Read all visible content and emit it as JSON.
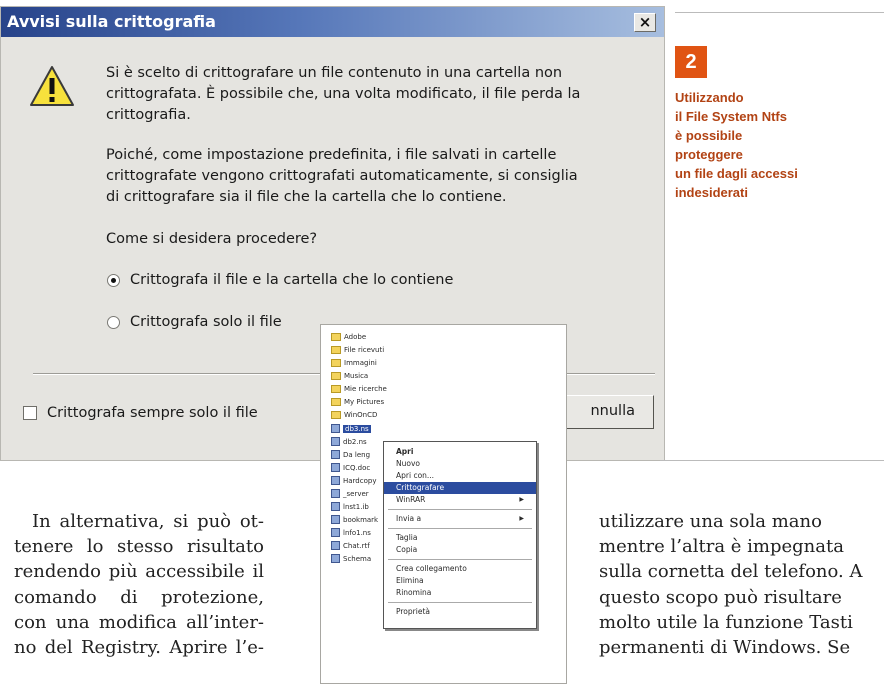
{
  "dialog": {
    "title": "Avvisi sulla crittografia",
    "close_glyph": "×",
    "icon": "warning-icon",
    "message1": [
      "Si è scelto di crittografare un file contenuto in una cartella non",
      "crittografata. È possibile che, una volta modificato, il file perda la",
      "crittografia."
    ],
    "message2": [
      "Poiché, come impostazione predefinita, i file salvati in cartelle",
      "crittografate vengono crittografati automaticamente, si consiglia",
      "di crittografare sia il file che la cartella che lo contiene."
    ],
    "question": "Come si desidera procedere?",
    "options": [
      {
        "label": "Crittografa il file e la cartella che lo contiene",
        "selected": true
      },
      {
        "label": "Crittografa solo il file",
        "selected": false
      }
    ],
    "checkbox_label": "Crittografa sempre solo il file",
    "cancel_visible_label": "nnulla"
  },
  "figure": {
    "number": "2",
    "caption": [
      "Utilizzando",
      "il File System Ntfs",
      "è possibile",
      "proteggere",
      "un file dagli accessi",
      "indesiderati"
    ],
    "accent_color": "#e05413"
  },
  "explorer": {
    "folders": [
      "Adobe",
      "File ricevuti",
      "Immagini",
      "Musica",
      "Mie ricerche",
      "My Pictures",
      "WinOnCD"
    ],
    "files": [
      "db3.ns",
      "db2.ns",
      "Da leng",
      "ICQ.doc",
      "Hardcopy",
      "_server",
      "lnst1.ib",
      "bookmark",
      "lnfo1.ns",
      "Chat.rtf",
      "Schema"
    ],
    "selected_file_index": 0,
    "context_menu": [
      {
        "label": "Apri",
        "bold": true
      },
      {
        "label": "Nuovo"
      },
      {
        "label": "Apri con..."
      },
      {
        "label": "Crittografare",
        "highlight": true
      },
      {
        "label": "WinRAR",
        "submenu": true
      },
      {
        "separator": true
      },
      {
        "label": "Invia a",
        "submenu": true
      },
      {
        "separator": true
      },
      {
        "label": "Taglia"
      },
      {
        "label": "Copia"
      },
      {
        "separator": true
      },
      {
        "label": "Crea collegamento"
      },
      {
        "label": "Elimina"
      },
      {
        "label": "Rinomina"
      },
      {
        "separator": true
      },
      {
        "label": "Proprietà"
      }
    ]
  },
  "body": {
    "left_lines": [
      "In alternativa, si può ot-",
      "tenere lo stesso risultato",
      "rendendo più accessibile il",
      "comando di protezione,",
      "con una modifica all’inter-",
      "no del Registry. Aprire l’e-"
    ],
    "right_lines": [
      "utilizzare una sola mano",
      "mentre l’altra è impegnata",
      "sulla cornetta del telefono. A",
      "questo scopo può risultare",
      "molto utile la funzione Tasti",
      "permanenti di Windows. Se"
    ]
  }
}
